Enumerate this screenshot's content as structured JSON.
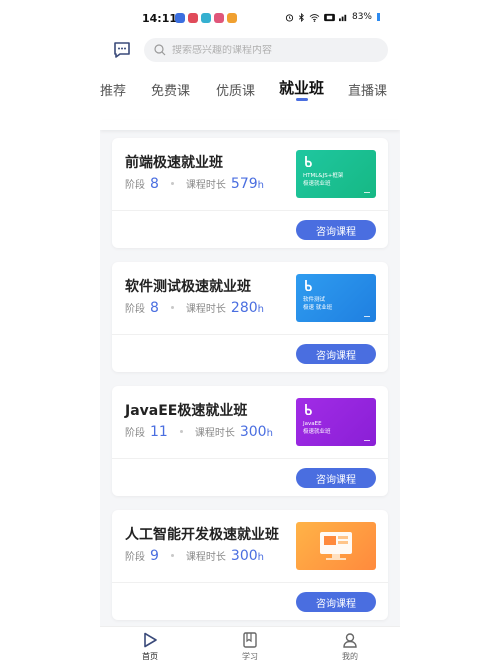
{
  "status_bar": {
    "time": "14:11",
    "battery": "83%"
  },
  "search": {
    "placeholder": "搜索感兴趣的课程内容"
  },
  "tabs": [
    {
      "label": "推荐",
      "active": false
    },
    {
      "label": "免费课",
      "active": false
    },
    {
      "label": "优质课",
      "active": false
    },
    {
      "label": "就业班",
      "active": true
    },
    {
      "label": "直播课",
      "active": false
    }
  ],
  "courses": [
    {
      "title": "前端极速就业班",
      "stage_label": "阶段",
      "stage_value": "8",
      "duration_label": "课程时长",
      "duration_value": "579",
      "duration_unit": "h",
      "thumb_lines": [
        "HTML&JS+框架",
        "极速就业班"
      ],
      "thumb_color_a": "#1fc7a0",
      "thumb_color_b": "#16b884",
      "button_label": "咨询课程"
    },
    {
      "title": "软件测试极速就业班",
      "stage_label": "阶段",
      "stage_value": "8",
      "duration_label": "课程时长",
      "duration_value": "280",
      "duration_unit": "h",
      "thumb_lines": [
        "软件测试",
        "极速 就业班"
      ],
      "thumb_color_a": "#2f9cf0",
      "thumb_color_b": "#1f7fe0",
      "button_label": "咨询课程"
    },
    {
      "title": "JavaEE极速就业班",
      "stage_label": "阶段",
      "stage_value": "11",
      "duration_label": "课程时长",
      "duration_value": "300",
      "duration_unit": "h",
      "thumb_lines": [
        "JavaEE",
        "极速就业班"
      ],
      "thumb_color_a": "#a12ce6",
      "thumb_color_b": "#8a1fd6",
      "button_label": "咨询课程"
    },
    {
      "title": "人工智能开发极速就业班",
      "stage_label": "阶段",
      "stage_value": "9",
      "duration_label": "课程时长",
      "duration_value": "300",
      "duration_unit": "h",
      "thumb_lines": [],
      "thumb_color_a": "#ffb347",
      "thumb_color_b": "#ff8a3d",
      "button_label": "咨询课程"
    }
  ],
  "bottom_nav": [
    {
      "label": "首页",
      "icon": "play-icon",
      "active": true
    },
    {
      "label": "学习",
      "icon": "book-icon",
      "active": false
    },
    {
      "label": "我的",
      "icon": "user-icon",
      "active": false
    }
  ],
  "colors": {
    "accent": "#4a6ee0"
  }
}
